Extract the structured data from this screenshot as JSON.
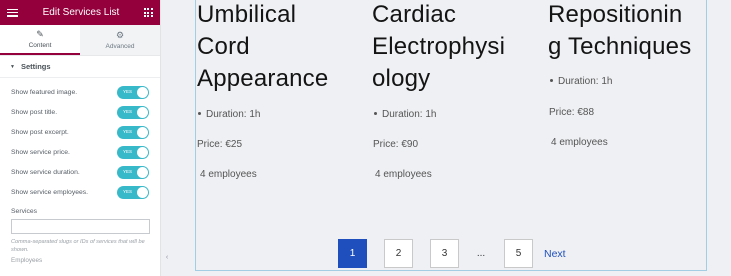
{
  "panel": {
    "title": "Edit Services List",
    "tabs": [
      {
        "label": "Content",
        "icon": "pencil-icon"
      },
      {
        "label": "Advanced",
        "icon": "gear-icon"
      }
    ],
    "section_title": "Settings",
    "toggles": [
      {
        "label": "Show featured image.",
        "state": "YES"
      },
      {
        "label": "Show post title.",
        "state": "YES"
      },
      {
        "label": "Show post excerpt.",
        "state": "YES"
      },
      {
        "label": "Show service price.",
        "state": "YES"
      },
      {
        "label": "Show service duration.",
        "state": "YES"
      },
      {
        "label": "Show service employees.",
        "state": "YES"
      }
    ],
    "services_label": "Services",
    "services_value": "",
    "services_help": "Comma-separated slugs or IDs of services that will be shown.",
    "cut_label": "Employees",
    "accent_color": "#93003c",
    "toggle_color": "#38b9c9"
  },
  "services": [
    {
      "title_lines": [
        "Umbilical",
        "Cord",
        "Appearance"
      ],
      "duration": "Duration: 1h",
      "price": "Price: €25",
      "employees": "4 employees"
    },
    {
      "title_lines": [
        "Cardiac",
        "Electrophysi",
        "ology"
      ],
      "duration": "Duration: 1h",
      "price": "Price: €90",
      "employees": "4 employees"
    },
    {
      "title_lines": [
        "Repositionin",
        "g Techniques"
      ],
      "duration": "Duration: 1h",
      "price": "Price: €88",
      "employees": "4 employees"
    }
  ],
  "pagination": {
    "pages": [
      "1",
      "2",
      "3"
    ],
    "current": "1",
    "ellipsis": "...",
    "last": "5",
    "next_label": "Next",
    "accent_color": "#1f4fbd"
  }
}
